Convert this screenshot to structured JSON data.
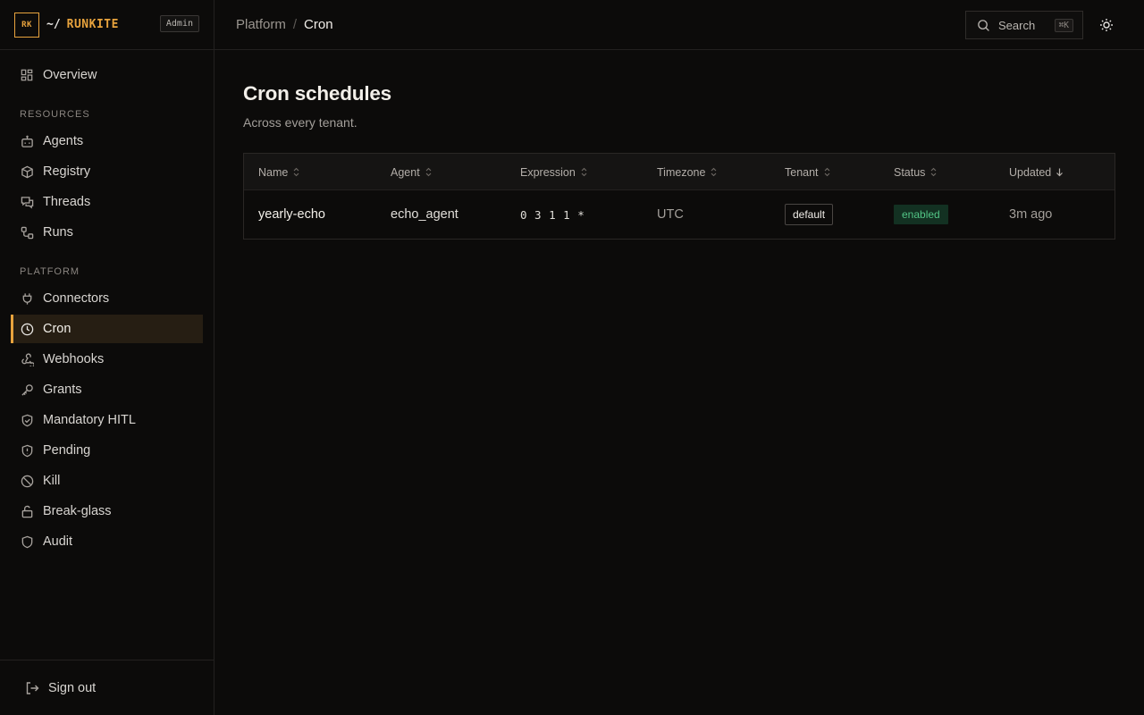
{
  "brand": {
    "logo_text": "RK",
    "prefix": "~/",
    "name": "RUNKITE",
    "role_badge": "Admin"
  },
  "sidebar": {
    "overview": {
      "label": "Overview",
      "icon": "overview-grid-icon"
    },
    "resources_label": "RESOURCES",
    "resources": [
      {
        "label": "Agents",
        "icon": "bot-icon"
      },
      {
        "label": "Registry",
        "icon": "package-icon"
      },
      {
        "label": "Threads",
        "icon": "messages-icon"
      },
      {
        "label": "Runs",
        "icon": "workflow-icon"
      }
    ],
    "platform_label": "PLATFORM",
    "platform": [
      {
        "label": "Connectors",
        "icon": "plug-icon"
      },
      {
        "label": "Cron",
        "icon": "clock-icon",
        "active": true
      },
      {
        "label": "Webhooks",
        "icon": "webhook-icon"
      },
      {
        "label": "Grants",
        "icon": "key-icon"
      },
      {
        "label": "Mandatory HITL",
        "icon": "shield-check-icon"
      },
      {
        "label": "Pending",
        "icon": "shield-alert-icon"
      },
      {
        "label": "Kill",
        "icon": "ban-icon"
      },
      {
        "label": "Break-glass",
        "icon": "lock-open-icon"
      },
      {
        "label": "Audit",
        "icon": "shield-icon"
      }
    ],
    "sign_out": "Sign out"
  },
  "topbar": {
    "breadcrumb_parent": "Platform",
    "breadcrumb_separator": "/",
    "breadcrumb_current": "Cron",
    "search_label": "Search",
    "search_shortcut": "⌘K"
  },
  "page": {
    "title": "Cron schedules",
    "subtitle": "Across every tenant."
  },
  "table": {
    "columns": [
      "Name",
      "Agent",
      "Expression",
      "Timezone",
      "Tenant",
      "Status",
      "Updated"
    ],
    "sorted_column": "Updated",
    "rows": [
      {
        "name": "yearly-echo",
        "agent": "echo_agent",
        "expression": "0 3 1 1 *",
        "timezone": "UTC",
        "tenant": "default",
        "status": "enabled",
        "updated": "3m ago"
      }
    ]
  },
  "colors": {
    "accent": "#e8a33d",
    "background": "#0c0b0a",
    "status_enabled_bg": "#133122",
    "status_enabled_fg": "#52c485"
  }
}
